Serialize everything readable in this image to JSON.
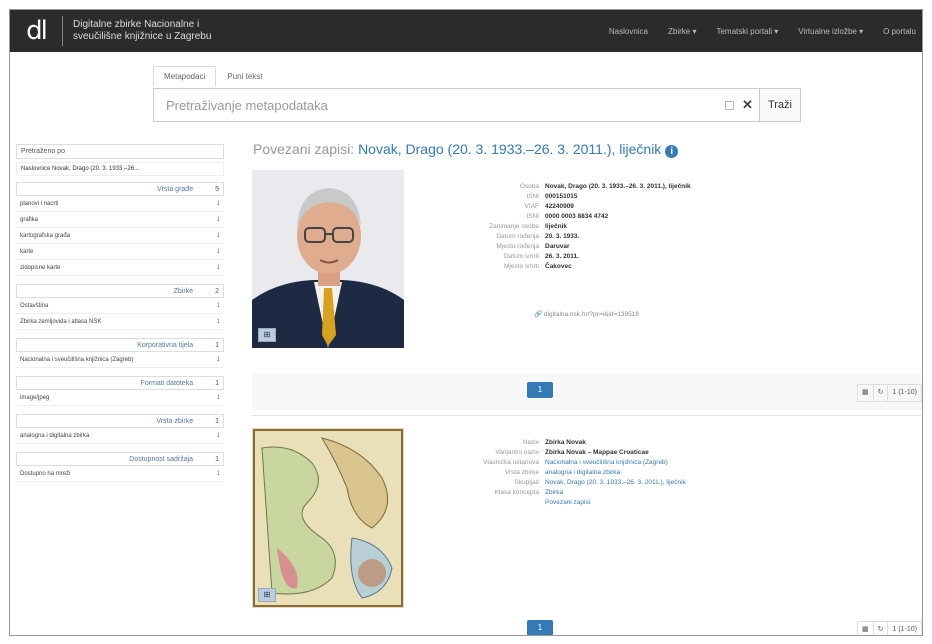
{
  "header": {
    "logo": "dl",
    "title_line1": "Digitalne zbirke Nacionalne i",
    "title_line2": "sveučilišne knjižnice u Zagrebu",
    "nav": [
      "Naslovnica",
      "Zbirke ▾",
      "Tematski portali ▾",
      "Virtualne izložbe ▾",
      "O portalu"
    ]
  },
  "search": {
    "tabs": [
      "Metapodaci",
      "Puni tekst"
    ],
    "placeholder": "Pretraživanje metapodataka",
    "clear_icon": "✕",
    "button": "Traži"
  },
  "sidebar": {
    "filtered_by": "Pretraženo po",
    "active_filter": "Naslovnice  Novak, Drago (20. 3. 1933.–26...",
    "facets": [
      {
        "title": "Vrsta građe",
        "count": "5",
        "items": [
          {
            "label": "planovi i nacrti",
            "count": "1"
          },
          {
            "label": "grafika",
            "count": "1"
          },
          {
            "label": "kartografska građa",
            "count": "1"
          },
          {
            "label": "karte",
            "count": "1"
          },
          {
            "label": "zidopisne karte",
            "count": "1"
          }
        ]
      },
      {
        "title": "Zbirke",
        "count": "2",
        "items": [
          {
            "label": "Ostavština",
            "count": "1"
          },
          {
            "label": "Zbirka zemljovida i atlasa NSK",
            "count": "1"
          }
        ]
      },
      {
        "title": "Korporativna tijela",
        "count": "1",
        "items": [
          {
            "label": "Nacionalna i sveučilišna knjižnica (Zagreb)",
            "count": "1"
          }
        ]
      },
      {
        "title": "Formati datoteka",
        "count": "1",
        "items": [
          {
            "label": "image/jpeg",
            "count": "1"
          }
        ]
      },
      {
        "title": "Vrsta zbirke",
        "count": "1",
        "items": [
          {
            "label": "analogna i digitalna zbirka",
            "count": "1"
          }
        ]
      },
      {
        "title": "Dostupnost sadržaja",
        "count": "1",
        "items": [
          {
            "label": "Dostupno na mreži",
            "count": "1"
          }
        ]
      }
    ]
  },
  "main": {
    "heading_prefix": "Povezani zapisi:",
    "heading_person": "Novak, Drago (20. 3. 1933.–26. 3. 2011.), liječnik",
    "record1": {
      "rows": [
        {
          "k": "Osoba",
          "v": "Novak, Drago (20. 3. 1933.–26. 3. 2011.), liječnik"
        },
        {
          "k": "ISNI",
          "v": "000151015"
        },
        {
          "k": "VIAF",
          "v": "42240909"
        },
        {
          "k": "ISNI",
          "v": "0000 0003 8834 4742"
        },
        {
          "k": "Zanimanje osobe",
          "v": "liječnik"
        },
        {
          "k": "Datum rođenja",
          "v": "20. 3. 1933."
        },
        {
          "k": "Mjesto rođenja",
          "v": "Daruvar"
        },
        {
          "k": "Datum smrti",
          "v": "26. 3. 2011."
        },
        {
          "k": "Mjesto smrti",
          "v": "Čakovec"
        }
      ],
      "link": "digitalna.nsk.hr/?pr=i&id=139518"
    },
    "record2": {
      "rows": [
        {
          "k": "Naziv",
          "v": "Zbirka Novak",
          "link": false
        },
        {
          "k": "Varijantni naziv",
          "v": "Zbirka Novak – Mappae Croaticae",
          "link": false
        },
        {
          "k": "Vlasnička ustanova",
          "v": "Nacionalna i sveučilišna knjižnica (Zagreb)",
          "link": true
        },
        {
          "k": "Vrsta zbirke",
          "v": "analogna i digitalna zbirka",
          "link": true
        },
        {
          "k": "Skupljač",
          "v": "Novak, Drago (20. 3. 1933.–26. 3. 2011.), liječnik",
          "link": true
        },
        {
          "k": "Klasa koncepta",
          "v": "Zbirka",
          "link": true
        },
        {
          "k": "",
          "v": "Povezani zapisi",
          "link": true
        }
      ]
    },
    "pager": "1",
    "tools": [
      "▦",
      "↻",
      "1 (1-10)"
    ],
    "thumb_btn": "⊞"
  },
  "colors": {
    "accent": "#337ab7",
    "navbar": "#2b2b2b"
  }
}
